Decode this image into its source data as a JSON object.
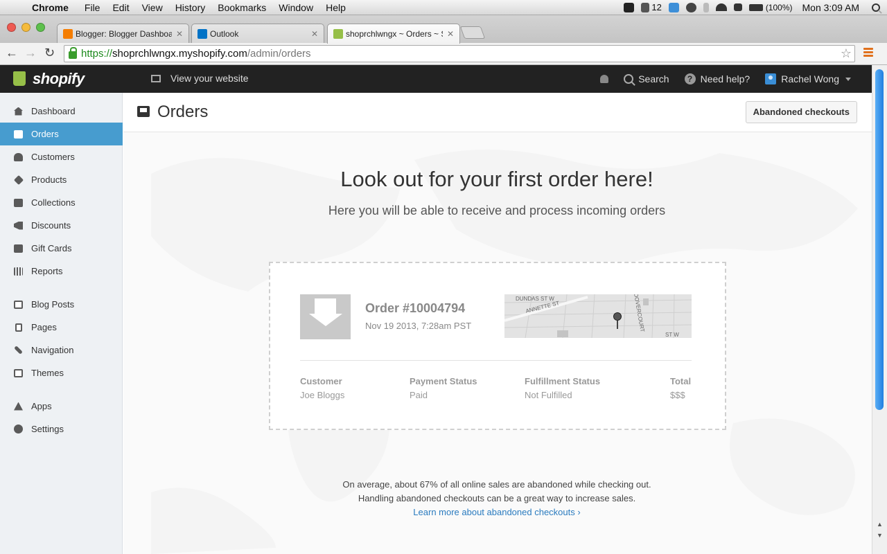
{
  "menubar": {
    "app": "Chrome",
    "items": [
      "File",
      "Edit",
      "View",
      "History",
      "Bookmarks",
      "Window",
      "Help"
    ],
    "status_num": "12",
    "battery": "(100%)",
    "clock": "Mon 3:09 AM"
  },
  "tabs": [
    {
      "title": "Blogger: Blogger Dashboard",
      "icon": "blogger-icon",
      "color": "#f57d00"
    },
    {
      "title": "Outlook",
      "icon": "outlook-icon",
      "color": "#0072c6"
    },
    {
      "title": "shoprchlwngx ~ Orders ~ Shopify",
      "icon": "shopify-icon",
      "color": "#96bf48",
      "active": true
    }
  ],
  "omnibox": {
    "scheme": "https://",
    "host": "shoprchlwngx.myshopify.com",
    "path": "/admin/orders"
  },
  "topbar": {
    "logo": "shopify",
    "view_site": "View your website",
    "search": "Search",
    "help": "Need help?",
    "user": "Rachel Wong"
  },
  "sidebar": {
    "items": [
      {
        "label": "Dashboard",
        "icon": "home-icon"
      },
      {
        "label": "Orders",
        "icon": "inbox-icon",
        "active": true
      },
      {
        "label": "Customers",
        "icon": "users-icon"
      },
      {
        "label": "Products",
        "icon": "tag-icon"
      },
      {
        "label": "Collections",
        "icon": "box-icon"
      },
      {
        "label": "Discounts",
        "icon": "megaphone-icon"
      },
      {
        "label": "Gift Cards",
        "icon": "gift-icon"
      },
      {
        "label": "Reports",
        "icon": "bar-chart-icon"
      },
      {
        "label": "Blog Posts",
        "icon": "blog-icon"
      },
      {
        "label": "Pages",
        "icon": "pages-icon"
      },
      {
        "label": "Navigation",
        "icon": "link-icon"
      },
      {
        "label": "Themes",
        "icon": "image-icon"
      },
      {
        "label": "Apps",
        "icon": "apps-icon"
      },
      {
        "label": "Settings",
        "icon": "gear-icon"
      }
    ]
  },
  "header": {
    "title": "Orders",
    "abandoned_button": "Abandoned checkouts"
  },
  "empty_state": {
    "title": "Look out for your first order here!",
    "subtitle": "Here you will be able to receive and process incoming orders"
  },
  "sample_order": {
    "number": "Order #10004794",
    "date": "Nov 19 2013, 7:28am PST",
    "streets": [
      "DUNDAS ST W",
      "ANNETTE ST",
      "DOVERCOURT",
      "ST W"
    ],
    "columns": [
      {
        "label": "Customer",
        "value": "Joe Bloggs"
      },
      {
        "label": "Payment Status",
        "value": "Paid"
      },
      {
        "label": "Fulfillment Status",
        "value": "Not Fulfilled"
      },
      {
        "label": "Total",
        "value": "$$$"
      }
    ]
  },
  "footer": {
    "line1": "On average, about 67% of all online sales are abandoned while checking out.",
    "line2": "Handling abandoned checkouts can be a great way to increase sales.",
    "link": "Learn more about abandoned checkouts ›"
  },
  "colors": {
    "accent": "#479ccf",
    "topbar": "#222222",
    "sidebar": "#eef1f4",
    "shopify_green": "#96bf48",
    "link": "#2a7bbf"
  }
}
